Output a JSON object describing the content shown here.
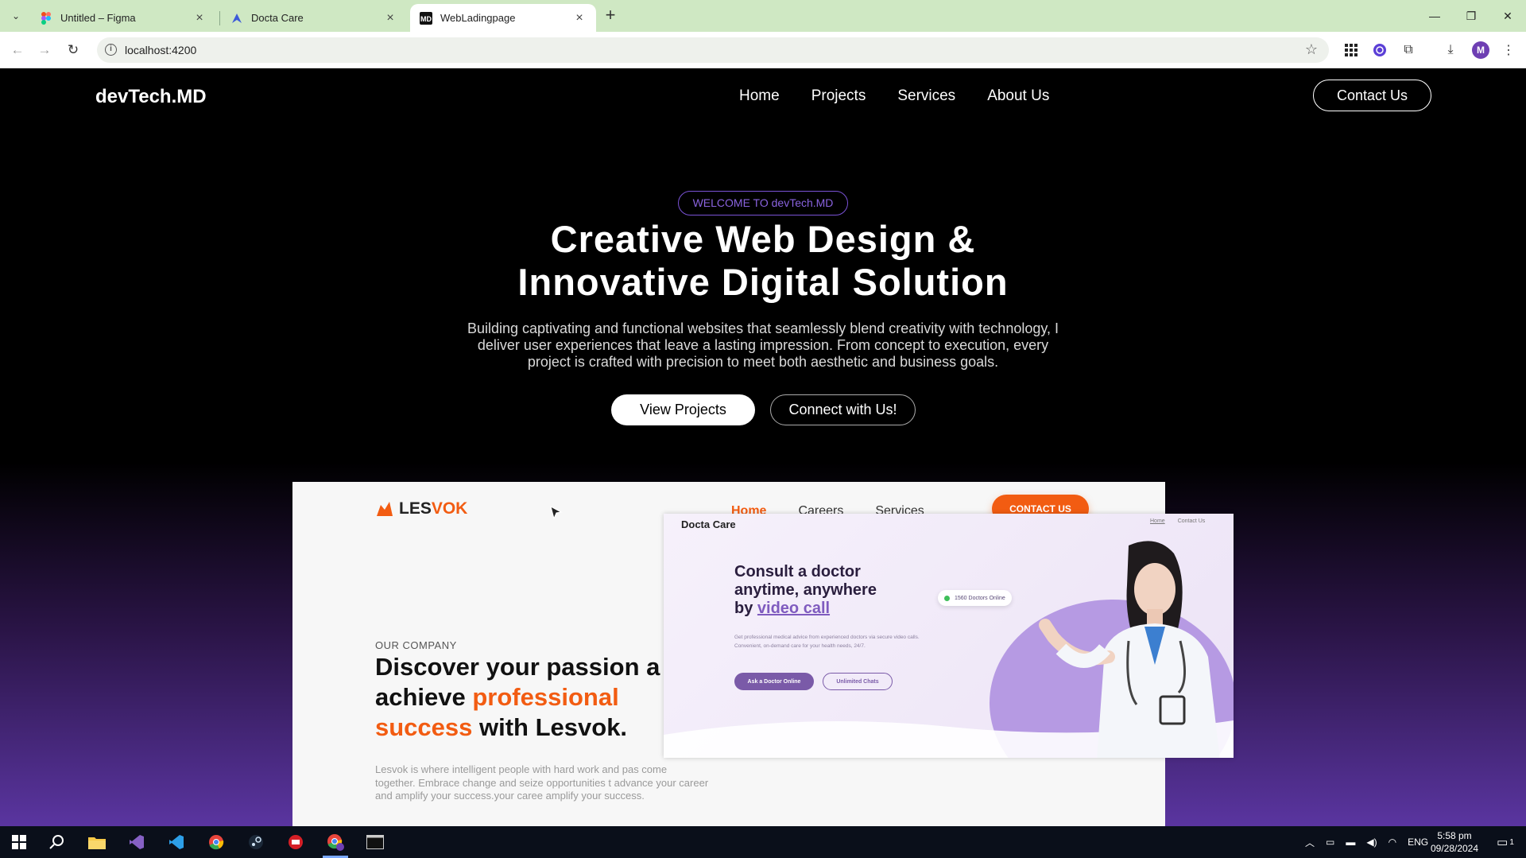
{
  "browser": {
    "tabs": [
      {
        "title": "Untitled – Figma",
        "icon": "figma-icon"
      },
      {
        "title": "Docta Care",
        "icon": "docta-icon"
      },
      {
        "title": "WebLadingpage",
        "icon": "md-icon",
        "active": true
      }
    ],
    "url": "localhost:4200",
    "profile_initial": "M"
  },
  "site": {
    "brand": "devTech.MD",
    "nav": [
      "Home",
      "Projects",
      "Services",
      "About Us"
    ],
    "contact_label": "Contact Us",
    "welcome_badge": "WELCOME TO devTech.MD",
    "hero_title_line1": "Creative Web Design &",
    "hero_title_line2": "Innovative Digital Solution",
    "hero_text": "Building captivating and functional websites that seamlessly blend creativity with technology, I deliver user experiences that leave a lasting impression. From concept to execution, every project is crafted with precision to meet both aesthetic and business goals.",
    "primary_cta": "View Projects",
    "secondary_cta": "Connect with Us!"
  },
  "lesvok": {
    "logo_part1": "LES",
    "logo_part2": "VOK",
    "nav": [
      "Home",
      "Careers",
      "Services"
    ],
    "contact_label": "CONTACT US",
    "eyebrow": "OUR COMPANY",
    "title_a": "Discover your passion a",
    "title_b1": "achieve ",
    "title_b2": "professional",
    "title_c1": "success",
    "title_c2": " with Lesvok.",
    "body": "Lesvok is where intelligent people with hard work and pas come together. Embrace change and seize opportunities t advance your career and amplify your success.your caree amplify your success.",
    "accent": "#f25c12"
  },
  "docta": {
    "brand": "Docta Care",
    "nav": [
      "Home",
      "Contact Us"
    ],
    "title_line1": "Consult a doctor",
    "title_line2": "anytime, anywhere",
    "title_line3_pre": "by ",
    "title_line3_link": "video call",
    "body": "Get professional medical advice from experienced doctors via secure video calls. Convenient, on-demand care for your health needs, 24/7.",
    "btn_primary": "Ask a Doctor Online",
    "btn_secondary": "Unlimited Chats",
    "online_badge": "1560 Doctors Online",
    "accent": "#7a5aa8"
  },
  "taskbar": {
    "lang": "ENG",
    "time": "5:58 pm",
    "date": "09/28/2024",
    "notifications": "1"
  }
}
